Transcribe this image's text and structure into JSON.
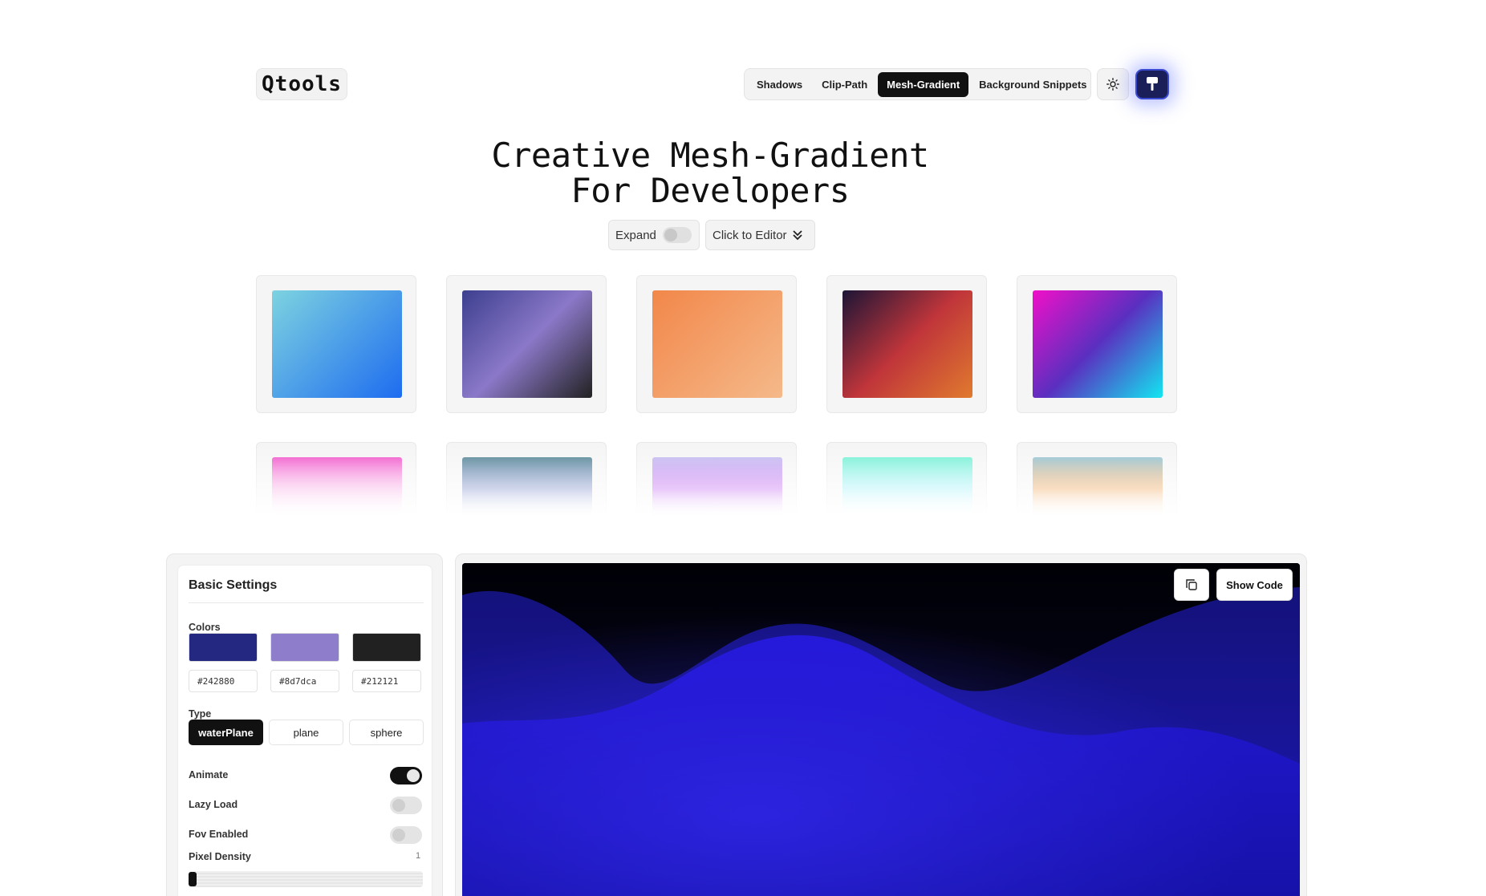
{
  "logo": {
    "text": "Qtools"
  },
  "nav": {
    "items": [
      {
        "label": "Shadows"
      },
      {
        "label": "Clip-Path"
      },
      {
        "label": "Mesh-Gradient"
      },
      {
        "label": "Background Snippets"
      }
    ],
    "active": "Mesh-Gradient"
  },
  "icons": {
    "theme": "sun-icon",
    "brush": "paint-brush-icon",
    "copy": "copy-icon",
    "editor": "double-chevron-down-icon"
  },
  "hero": {
    "line1": "Creative Mesh-Gradient",
    "line2": "For Developers",
    "expand_label": "Expand",
    "editor_label": "Click to Editor"
  },
  "gradients": [
    {
      "from": "#7dd3e0",
      "to": "#1e6cf0"
    },
    {
      "from": "#3d3f8f",
      "via": "#8b78c8",
      "to": "#222222"
    },
    {
      "from": "#f2874a",
      "to": "#f5b98a"
    },
    {
      "from": "#1c1536",
      "via": "#c0353a",
      "to": "#e07a2e"
    },
    {
      "from": "#f010c8",
      "via": "#5a2fc0",
      "to": "#12e6f0"
    },
    {
      "from": "#f04fc8",
      "to": "#ffffff"
    },
    {
      "from": "#4d8090",
      "via": "#7a8ac8",
      "to": "#ffffff"
    },
    {
      "from": "#c0b8f0",
      "via": "#c060f0",
      "to": "#ffffff"
    },
    {
      "from": "#70f0d0",
      "via": "#a0f0f8",
      "to": "#ffffff"
    },
    {
      "from": "#90c0d0",
      "via": "#f0a050",
      "to": "#ffffff"
    }
  ],
  "settings": {
    "title": "Basic Settings",
    "colors_label": "Colors",
    "colors": [
      "#242880",
      "#8d7dca",
      "#212121"
    ],
    "type_label": "Type",
    "types": [
      "waterPlane",
      "plane",
      "sphere"
    ],
    "active_type": "waterPlane",
    "animate_label": "Animate",
    "animate": true,
    "lazy_label": "Lazy Load",
    "lazy": false,
    "fov_label": "Fov Enabled",
    "fov": false,
    "density_label": "Pixel Density",
    "density_value": "1"
  },
  "preview": {
    "show_code_label": "Show Code"
  }
}
